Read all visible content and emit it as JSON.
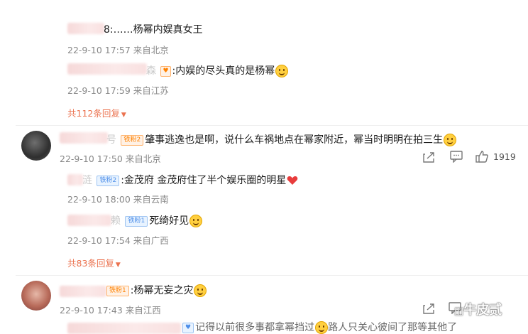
{
  "thread1": {
    "reply1": {
      "name_suffix": "8",
      "text": ":……杨幂内娱真女王",
      "time": "22-9-10 17:57 来自北京"
    },
    "reply2": {
      "name_suffix": "森",
      "text": ":内娱的尽头真的是杨幂",
      "time": "22-9-10 17:59 来自江苏"
    },
    "more": "共112条回复"
  },
  "comment2": {
    "name_suffix": "号",
    "badge": "铁粉2",
    "text": "肇事逃逸也是啊，说什么车祸地点在幂家附近，幂当时明明在拍三生",
    "time": "22-9-10 17:50 来自北京",
    "likes": "1919",
    "replies": [
      {
        "name_suffix": "涟",
        "badge": "铁粉2",
        "text": ":金茂府 金茂府住了半个娱乐圈的明星",
        "time": "22-9-10 18:00 来自云南"
      },
      {
        "name_suffix": "赖",
        "badge": "铁粉1",
        "text": "死绮好见",
        "time": "22-9-10 17:54 来自广西"
      }
    ],
    "more": "共83条回复"
  },
  "comment3": {
    "badge": "铁粉1",
    "text": ":杨幂无妄之灾",
    "time": "22-9-10 17:43 来自江西",
    "reply_partial": "记得以前很多事都拿幂挡过",
    "reply_partial2": "路人只关心彼间了那等其他了"
  },
  "watermark": "牛皮贰",
  "icons": {
    "share": "share-icon",
    "comment": "comment-icon",
    "like": "thumbs-up-icon",
    "more": "chevron-down-icon"
  },
  "colors": {
    "link": "#eb7350",
    "meta": "#888888",
    "badge_orange": "#ff8200",
    "badge_blue": "#4d8ee9"
  }
}
